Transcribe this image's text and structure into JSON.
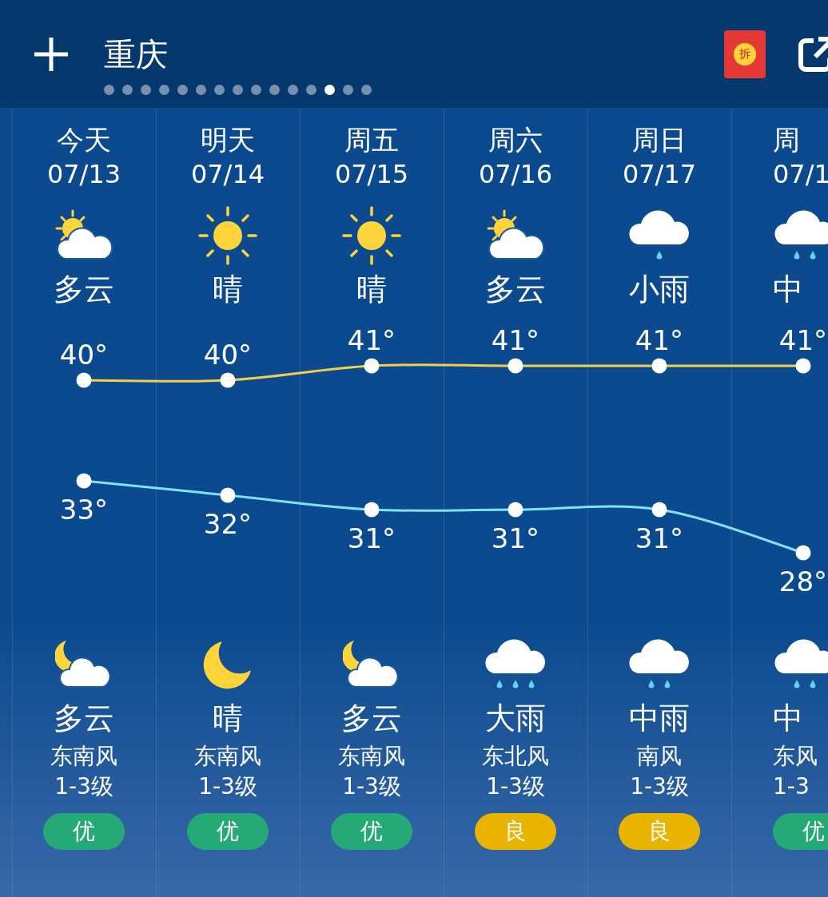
{
  "header": {
    "city": "重庆",
    "red_packet_label": "拆",
    "pages": [
      {
        "selected": false
      },
      {
        "selected": false
      },
      {
        "selected": false
      },
      {
        "selected": false
      },
      {
        "selected": false
      },
      {
        "selected": false
      },
      {
        "selected": false
      },
      {
        "selected": false
      },
      {
        "selected": false
      },
      {
        "selected": false
      },
      {
        "selected": false
      },
      {
        "selected": false
      },
      {
        "selected": true
      },
      {
        "selected": false
      },
      {
        "selected": false
      }
    ]
  },
  "days": [
    {
      "day": "今天",
      "date": "07/13",
      "day_weather": {
        "kind": "partly_cloudy",
        "condition": "多云"
      },
      "night_weather": {
        "kind": "night_cloudy",
        "condition": "多云"
      },
      "wind": "东南风",
      "wind_level": "1-3级",
      "aqi": "优",
      "color": "#25a977"
    },
    {
      "day": "明天",
      "date": "07/14",
      "day_weather": {
        "kind": "sunny",
        "condition": "晴"
      },
      "night_weather": {
        "kind": "moon",
        "condition": "晴"
      },
      "wind": "东南风",
      "wind_level": "1-3级",
      "aqi": "优",
      "color": "#25a977"
    },
    {
      "day": "周五",
      "date": "07/15",
      "day_weather": {
        "kind": "sunny",
        "condition": "晴"
      },
      "night_weather": {
        "kind": "night_cloudy",
        "condition": "多云"
      },
      "wind": "东南风",
      "wind_level": "1-3级",
      "aqi": "优",
      "color": "#25a977"
    },
    {
      "day": "周六",
      "date": "07/16",
      "day_weather": {
        "kind": "partly_cloudy",
        "condition": "多云"
      },
      "night_weather": {
        "kind": "rain_heavy",
        "condition": "大雨"
      },
      "wind": "东北风",
      "wind_level": "1-3级",
      "aqi": "良",
      "color": "#e8b400"
    },
    {
      "day": "周日",
      "date": "07/17",
      "day_weather": {
        "kind": "rain_light",
        "condition": "小雨"
      },
      "night_weather": {
        "kind": "rain_moderate",
        "condition": "中雨"
      },
      "wind": "南风",
      "wind_level": "1-3级",
      "aqi": "良",
      "color": "#e8b400"
    },
    {
      "day": "周",
      "date": "07/1",
      "day_weather": {
        "kind": "rain_moderate",
        "condition": "中"
      },
      "night_weather": {
        "kind": "rain_moderate",
        "condition": "中"
      },
      "wind": "东风",
      "wind_level": "1-3",
      "aqi": "优",
      "color": "#25a977"
    }
  ],
  "chart_data": {
    "type": "line",
    "series": [
      {
        "marker": "circle",
        "color": "#f2d04a",
        "values": [
          40,
          40,
          41,
          41,
          41,
          41
        ],
        "value_labels": [
          "40°",
          "40°",
          "41°",
          "41°",
          "41°",
          "41°"
        ]
      },
      {
        "marker": "circle",
        "color": "#7fe3f5",
        "values": [
          33,
          32,
          31,
          31,
          31,
          28
        ],
        "value_labels": [
          "33°",
          "32°",
          "31°",
          "31°",
          "31°",
          "28°"
        ]
      }
    ]
  }
}
